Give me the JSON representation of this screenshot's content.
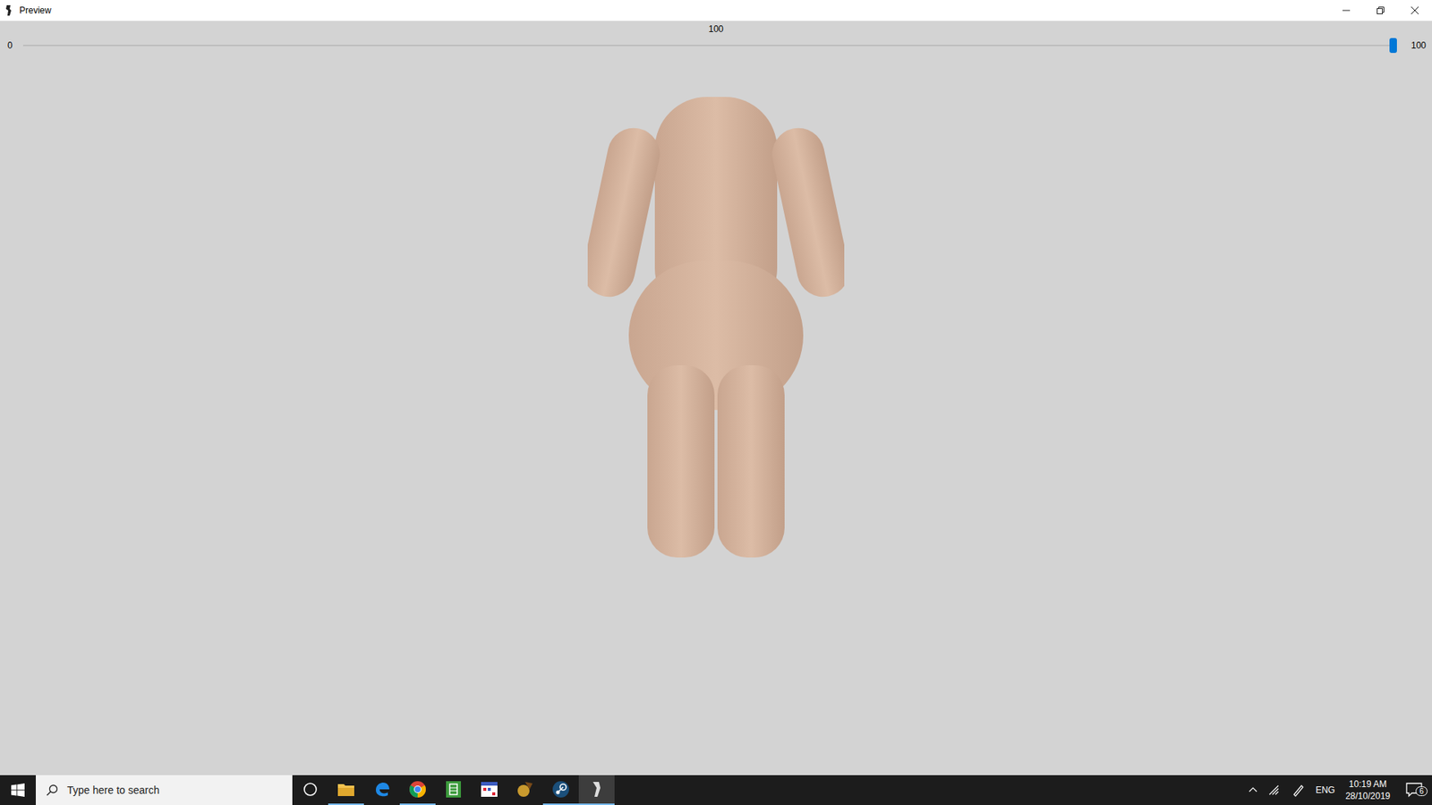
{
  "window": {
    "title": "Preview"
  },
  "slider": {
    "min": "0",
    "max": "100",
    "value": "100",
    "level": 1.0
  },
  "taskbar": {
    "search": {
      "placeholder": "Type here to search"
    },
    "apps": [
      {
        "kind": "task",
        "running": false,
        "active": false
      },
      {
        "kind": "folder",
        "running": true,
        "active": false
      },
      {
        "kind": "edge",
        "running": false,
        "active": false
      },
      {
        "kind": "chrome",
        "running": true,
        "active": false
      },
      {
        "kind": "sheet",
        "running": false,
        "active": false
      },
      {
        "kind": "calendar",
        "running": false,
        "active": false
      },
      {
        "kind": "tool",
        "running": false,
        "active": false
      },
      {
        "kind": "steam",
        "running": true,
        "active": false
      },
      {
        "kind": "preview",
        "running": true,
        "active": true
      }
    ],
    "tray": {
      "language": "ENG",
      "time": "10:19 AM",
      "date": "28/10/2019",
      "notifications": "6"
    }
  }
}
